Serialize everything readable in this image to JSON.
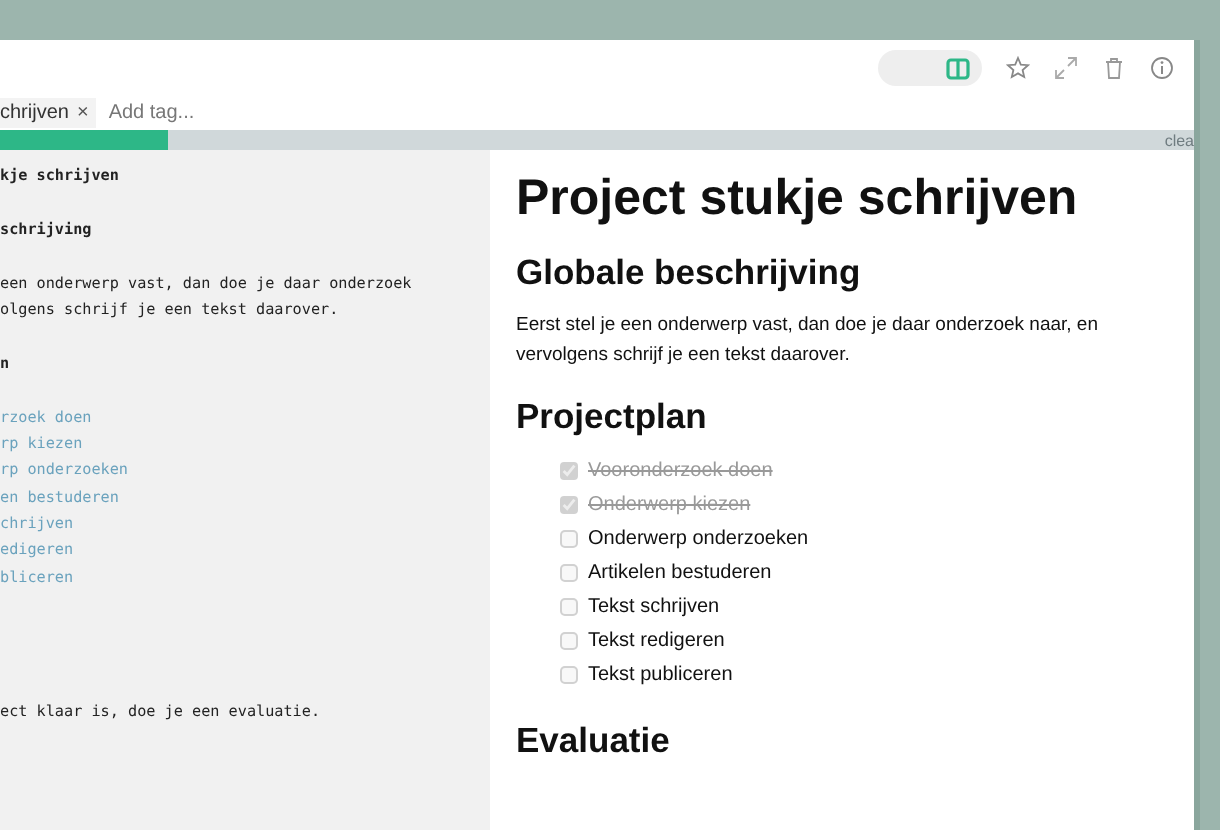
{
  "toolbar": {
    "split_view": {
      "on": true
    }
  },
  "tags": {
    "items": [
      {
        "label": "chrijven",
        "remove": "×"
      }
    ],
    "placeholder": "Add tag..."
  },
  "progress": {
    "level": 0.14,
    "action": "clea"
  },
  "editor": {
    "lines": [
      {
        "kind": "heading",
        "text": "kje schrijven"
      },
      {
        "kind": "blank"
      },
      {
        "kind": "heading",
        "text": "schrijving"
      },
      {
        "kind": "blank"
      },
      {
        "kind": "text",
        "text": "een onderwerp vast, dan doe je daar onderzoek"
      },
      {
        "kind": "text",
        "text": "olgens schrijf je een tekst daarover."
      },
      {
        "kind": "blank"
      },
      {
        "kind": "heading",
        "text": "n"
      },
      {
        "kind": "blank"
      },
      {
        "kind": "task",
        "text": "rzoek doen"
      },
      {
        "kind": "task",
        "text": "rp kiezen"
      },
      {
        "kind": "task",
        "text": "rp onderzoeken"
      },
      {
        "kind": "task",
        "text": "en bestuderen"
      },
      {
        "kind": "task",
        "text": "chrijven"
      },
      {
        "kind": "task",
        "text": "edigeren"
      },
      {
        "kind": "task",
        "text": "bliceren"
      },
      {
        "kind": "blank"
      },
      {
        "kind": "blank"
      },
      {
        "kind": "blank"
      },
      {
        "kind": "blank"
      },
      {
        "kind": "text",
        "text": "ect klaar is, doe je een evaluatie."
      }
    ]
  },
  "preview": {
    "title": "Project stukje schrijven",
    "sections": [
      {
        "heading": "Globale beschrijving",
        "paragraph": "Eerst stel je een onderwerp vast, dan doe je daar onderzoek naar, en vervolgens schrijf je een tekst daarover."
      },
      {
        "heading": "Projectplan",
        "tasks": [
          {
            "label": "Vooronderzoek doen",
            "checked": true
          },
          {
            "label": "Onderwerp kiezen",
            "checked": true
          },
          {
            "label": "Onderwerp onderzoeken",
            "checked": false
          },
          {
            "label": "Artikelen bestuderen",
            "checked": false
          },
          {
            "label": "Tekst schrijven",
            "checked": false
          },
          {
            "label": "Tekst redigeren",
            "checked": false
          },
          {
            "label": "Tekst publiceren",
            "checked": false
          }
        ]
      },
      {
        "heading": "Evaluatie"
      }
    ]
  }
}
